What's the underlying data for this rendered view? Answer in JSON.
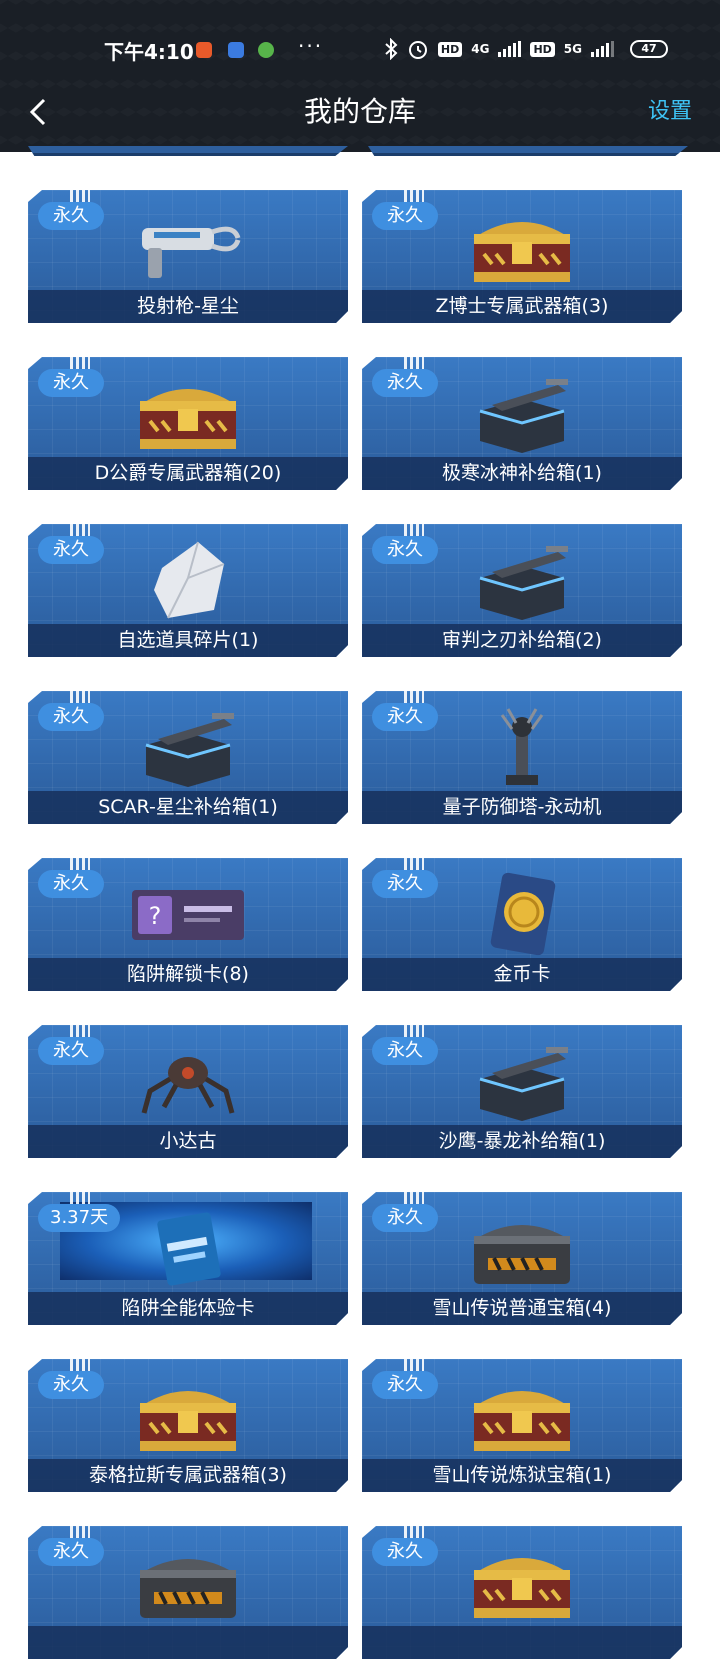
{
  "status_bar": {
    "time": "下午4:10",
    "dots": "···",
    "net1": "4G",
    "net2": "5G",
    "hd": "HD",
    "battery": "47"
  },
  "header": {
    "title": "我的仓库",
    "settings_label": "设置"
  },
  "items": [
    {
      "name": "投射枪-星尘",
      "badge": "永久",
      "icon": "gun-icon"
    },
    {
      "name": "Z博士专属武器箱(3)",
      "badge": "永久",
      "icon": "gold-chest-icon"
    },
    {
      "name": "D公爵专属武器箱(20)",
      "badge": "永久",
      "icon": "gold-chest-icon"
    },
    {
      "name": "极寒冰神补给箱(1)",
      "badge": "永久",
      "icon": "supply-box-icon"
    },
    {
      "name": "自选道具碎片(1)",
      "badge": "永久",
      "icon": "crystal-shard-icon"
    },
    {
      "name": "审判之刃补给箱(2)",
      "badge": "永久",
      "icon": "supply-box-icon"
    },
    {
      "name": "SCAR-星尘补给箱(1)",
      "badge": "永久",
      "icon": "supply-box-icon"
    },
    {
      "name": "量子防御塔-永动机",
      "badge": "永久",
      "icon": "tower-icon"
    },
    {
      "name": "陷阱解锁卡(8)",
      "badge": "永久",
      "icon": "unlock-card-icon"
    },
    {
      "name": "金币卡",
      "badge": "永久",
      "icon": "coin-card-icon"
    },
    {
      "name": "小达古",
      "badge": "永久",
      "icon": "spider-robot-icon"
    },
    {
      "name": "沙鹰-暴龙补给箱(1)",
      "badge": "永久",
      "icon": "supply-box-icon"
    },
    {
      "name": "陷阱全能体验卡",
      "badge": "3.37天",
      "icon": "trial-card-icon"
    },
    {
      "name": "雪山传说普通宝箱(4)",
      "badge": "永久",
      "icon": "iron-chest-icon"
    },
    {
      "name": "泰格拉斯专属武器箱(3)",
      "badge": "永久",
      "icon": "gold-chest-icon"
    },
    {
      "name": "雪山传说炼狱宝箱(1)",
      "badge": "永久",
      "icon": "gold-chest-icon"
    },
    {
      "name": "",
      "badge": "永久",
      "icon": "iron-chest-icon"
    },
    {
      "name": "",
      "badge": "永久",
      "icon": "gold-chest-icon"
    }
  ],
  "colors": {
    "accent": "#3ec3f5",
    "card": "#2f64a6",
    "badge": "#3f8fe0",
    "header": "#1a1f26"
  }
}
